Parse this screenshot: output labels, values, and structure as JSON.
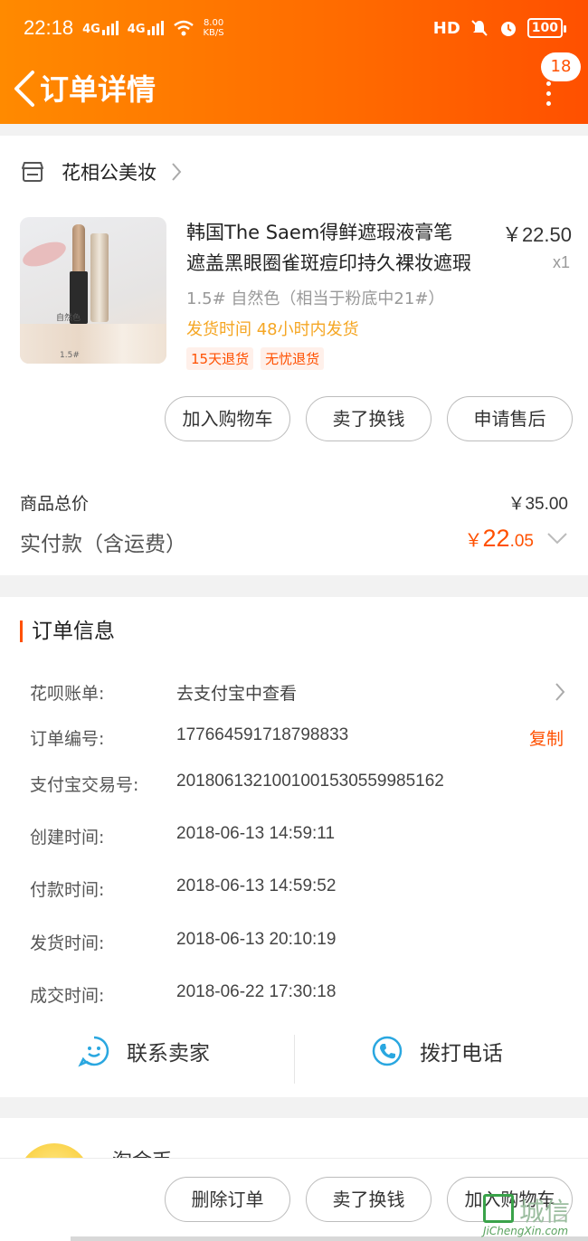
{
  "status_bar": {
    "time": "22:18",
    "signal1": "4G",
    "signal2": "4G",
    "net_speed": "8.00",
    "net_unit": "KB/S",
    "hd": "HD",
    "battery": "100"
  },
  "nav": {
    "title": "订单详情",
    "badge_count": "18"
  },
  "shop": {
    "name": "花相公美妆"
  },
  "product": {
    "title_line1": "韩国The Saem得鲜遮瑕液膏笔",
    "title_line2": "遮盖黑眼圈雀斑痘印持久裸妆遮瑕",
    "price": "￥22.50",
    "quantity": "x1",
    "sku": "1.5# 自然色（相当于粉底中21#）",
    "ship_label": "发货时间",
    "ship_value": "48小时内发货",
    "tags": [
      "15天退货",
      "无忧退货"
    ],
    "image_label1": "自然色",
    "image_label2": "1.5#"
  },
  "item_actions": {
    "add_cart": "加入购物车",
    "resell": "卖了换钱",
    "after_sale": "申请售后"
  },
  "summary": {
    "total_label": "商品总价",
    "total_value": "￥35.00",
    "paid_label": "实付款（含运费）",
    "paid_currency": "￥",
    "paid_int": "22",
    "paid_dec": ".05"
  },
  "order_info": {
    "section_title": "订单信息",
    "huabei_label": "花呗账单:",
    "huabei_value": "去支付宝中查看",
    "order_no_label": "订单编号:",
    "order_no_value": "177664591718798833",
    "copy_label": "复制",
    "alipay_label": "支付宝交易号:",
    "alipay_value": "2018061321001001530559985162",
    "created_label": "创建时间:",
    "created_value": "2018-06-13 14:59:11",
    "paid_label": "付款时间:",
    "paid_value": "2018-06-13 14:59:52",
    "shipped_label": "发货时间:",
    "shipped_value": "2018-06-13 20:10:19",
    "done_label": "成交时间:",
    "done_value": "2018-06-22 17:30:18"
  },
  "contact": {
    "seller": "联系卖家",
    "phone": "拨打电话"
  },
  "peek": {
    "name": "淘金币"
  },
  "bottom_actions": {
    "delete": "删除订单",
    "resell": "卖了换钱",
    "add_cart": "加入购物车"
  },
  "watermark": {
    "cn": "城信",
    "en": "JiChengXin.com"
  },
  "colors": {
    "brand": "#ff5000",
    "header_start": "#ff8a00",
    "ship_time": "#f5a623",
    "contact_icon": "#2aa7e0"
  }
}
